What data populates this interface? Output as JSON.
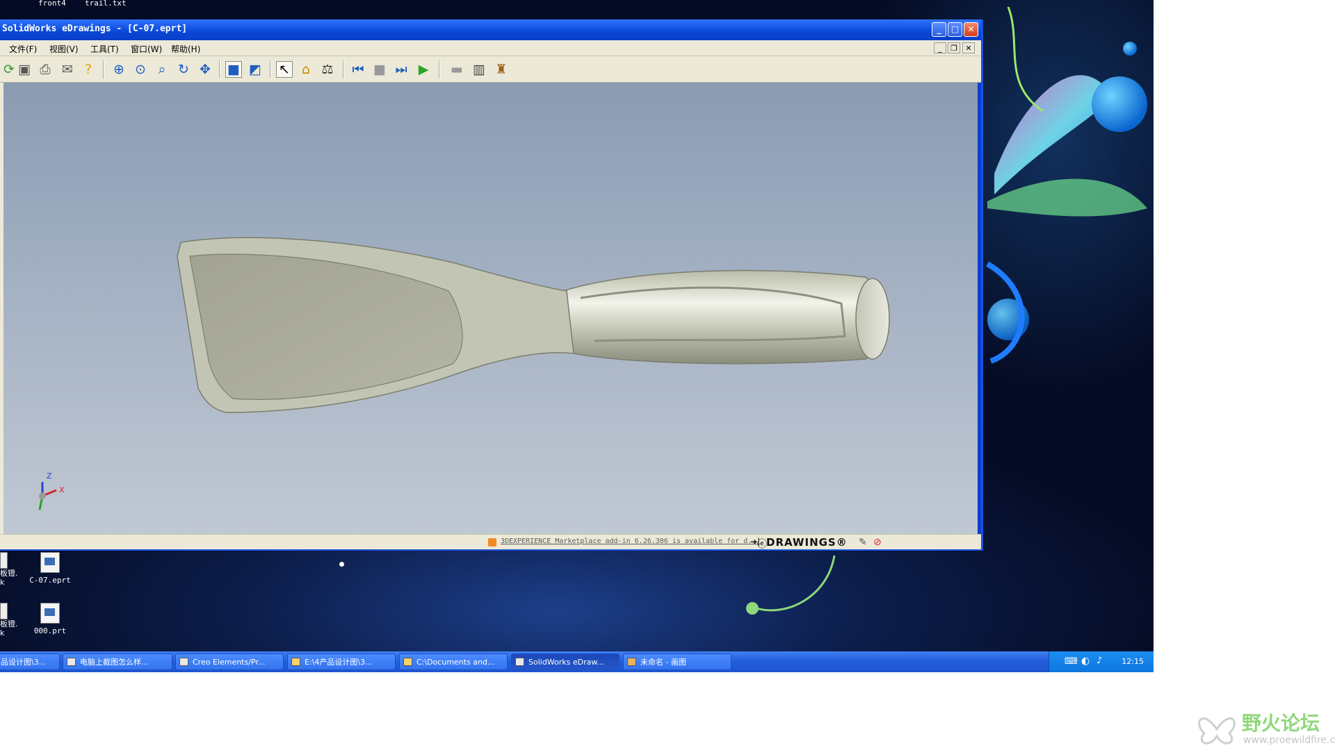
{
  "desktop": {
    "top_labels": [
      "front4",
      "trail.txt"
    ],
    "icons": [
      {
        "label": "C-07.eprt"
      },
      {
        "label": "000.prt"
      }
    ],
    "partial_icons": [
      "板镫.\nk",
      "板镫.\nk"
    ]
  },
  "window": {
    "title": "SolidWorks eDrawings - [C-07.eprt]",
    "buttons": {
      "minimize": "_",
      "maximize": "□",
      "close": "✕"
    },
    "mdi_buttons": {
      "minimize": "_",
      "restore": "❐",
      "close": "✕"
    },
    "menu": [
      "文件(F)",
      "视图(V)",
      "工具(T)",
      "窗口(W)",
      "帮助(H)"
    ],
    "status": {
      "message": "3DEXPERIENCE Marketplace add-in 6.26.306 is available for d...",
      "logo": "DRAWINGS®",
      "arrow": "➔|"
    },
    "triad": {
      "x": "X",
      "z": "Z"
    }
  },
  "taskbar": {
    "tasks": [
      {
        "label": "品设计图\\3..."
      },
      {
        "label": "电脑上截图怎么样..."
      },
      {
        "label": "Creo Elements/Pr..."
      },
      {
        "label": "E:\\4产品设计图\\3..."
      },
      {
        "label": "C:\\Documents and..."
      },
      {
        "label": "SolidWorks eDraw..."
      },
      {
        "label": "未命名 - 画图"
      }
    ],
    "clock": "12:15"
  },
  "watermark": {
    "name": "野火论坛",
    "url": "www.proewildfire.cn"
  },
  "colors": {
    "titlebar": "#0a47d6",
    "taskbar": "#245edb",
    "viewport_top": "#8a9bb3",
    "model": "#a8aa98"
  }
}
